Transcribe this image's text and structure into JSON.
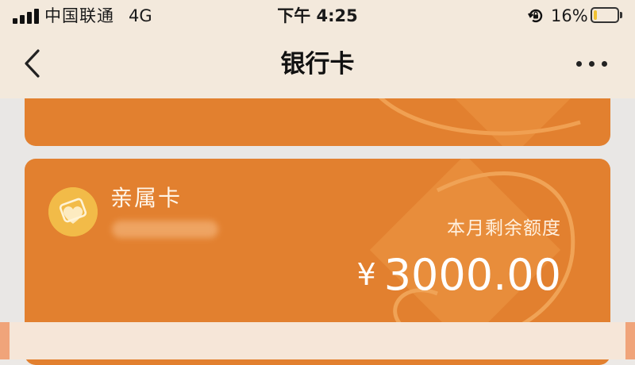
{
  "status_bar": {
    "carrier": "中国联通",
    "network": "4G",
    "time": "下午 4:25",
    "battery_percent": "16%",
    "battery_level": 0.16,
    "battery_color": "#f1c232",
    "icons": [
      "signal-icon",
      "rotation-lock-icon",
      "battery-icon"
    ]
  },
  "nav": {
    "title": "银行卡",
    "back_icon": "chevron-left-icon",
    "more_icon": "more-dots-icon"
  },
  "card": {
    "name": "亲属卡",
    "quota_label": "本月剩余额度",
    "currency": "¥",
    "amount": "3000.00",
    "logo_icon": "heart-card-icon",
    "color": "#e2802f",
    "logo_color": "#f2bb48"
  }
}
